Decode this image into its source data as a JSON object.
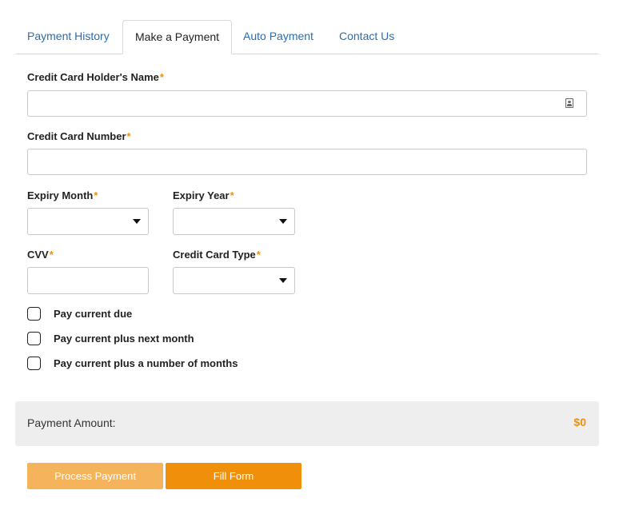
{
  "tabs": [
    {
      "label": "Payment History"
    },
    {
      "label": "Make a Payment"
    },
    {
      "label": "Auto Payment"
    },
    {
      "label": "Contact Us"
    }
  ],
  "form": {
    "required_marker": "*",
    "holder_name": {
      "label": "Credit Card Holder's Name",
      "value": ""
    },
    "card_number": {
      "label": "Credit Card Number",
      "value": ""
    },
    "expiry_month": {
      "label": "Expiry Month",
      "selected": ""
    },
    "expiry_year": {
      "label": "Expiry Year",
      "selected": ""
    },
    "cvv": {
      "label": "CVV",
      "value": ""
    },
    "card_type": {
      "label": "Credit Card Type",
      "selected": ""
    }
  },
  "options": [
    {
      "label": "Pay current due",
      "checked": false
    },
    {
      "label": "Pay current plus next month",
      "checked": false
    },
    {
      "label": "Pay current plus a number of months",
      "checked": false
    }
  ],
  "amount": {
    "label": "Payment Amount:",
    "value": "$0"
  },
  "buttons": {
    "process": "Process Payment",
    "fill": "Fill Form"
  },
  "colors": {
    "accent": "#f0900a",
    "accent_light": "#f5b45c",
    "link": "#2a6db0",
    "amount_bg": "#eeeeee"
  }
}
